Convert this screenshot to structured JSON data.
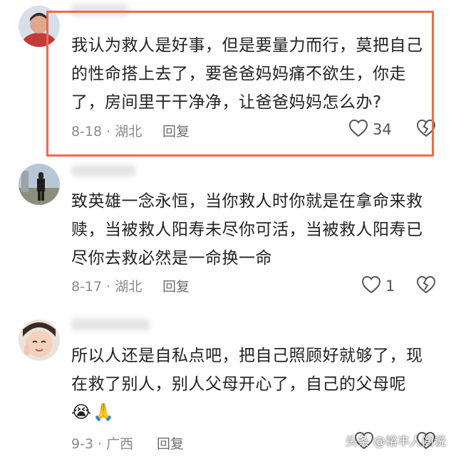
{
  "comments": [
    {
      "text": "我认为救人是好事，但是要量力而行，莫把自己\n的性命搭上去了，要爸爸妈妈痛不欲生，你走\n了，房间里干干净净，让爸爸妈妈怎么办?",
      "date_location": "8-18 · 湖北",
      "reply_label": "回复",
      "likes": "34"
    },
    {
      "text": "致英雄一念永恒，当你救人时你就是在拿命来救\n赎，当被救人阳寿未尽你可活，当被救人阳寿已\n尽你去救必然是一命换一命",
      "date_location": "8-17 · 湖北",
      "reply_label": "回复",
      "likes": "1"
    },
    {
      "text": "所以人还是自私点吧，把自己照顾好就够了，现\n在救了别人，别人父母开心了，自己的父母呢",
      "date_location": "9-3 · 广西",
      "reply_label": "回复",
      "emoji": [
        "😭",
        "🙏"
      ]
    }
  ],
  "icons": {
    "like": "heart-outline-icon",
    "dislike": "broken-heart-icon"
  },
  "watermark": "头条 @裕丰人间说",
  "colors": {
    "highlight": "#ef6a4a",
    "meta": "#8a8a8a",
    "text": "#222222"
  }
}
